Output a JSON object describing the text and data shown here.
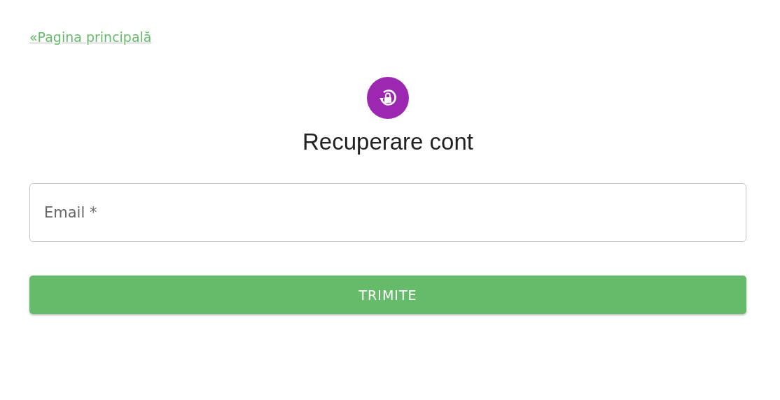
{
  "back_link": {
    "label": "«Pagina principală"
  },
  "title": "Recuperare cont",
  "email_field": {
    "placeholder": "Email *"
  },
  "submit_button": {
    "label": "TRIMITE"
  }
}
